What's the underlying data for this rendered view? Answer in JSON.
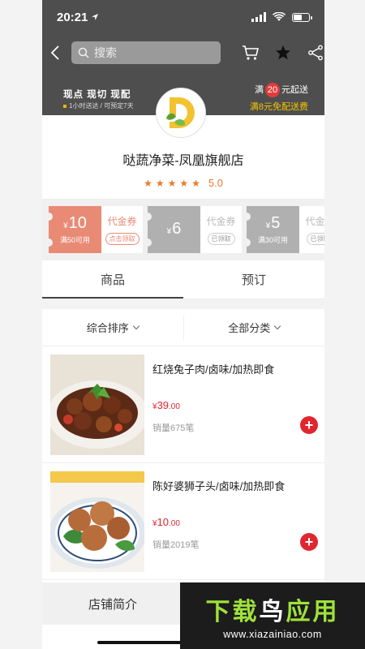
{
  "status": {
    "time": "20:21"
  },
  "search": {
    "placeholder": "搜索"
  },
  "banner": {
    "tags": "现点 现切 现配",
    "sub": "1小时送达 / 可预定7天",
    "min_prefix": "满",
    "min_amount": "20",
    "min_suffix": "元起送",
    "free_shipping": "满8元免配送费"
  },
  "shop": {
    "name": "哒蔬净菜-凤凰旗舰店",
    "stars": "★★★★★",
    "rating": "5.0"
  },
  "coupons": [
    {
      "amount": "10",
      "currency": "¥",
      "condition": "满50可用",
      "type": "代金券",
      "action": "点击领取",
      "state": "active"
    },
    {
      "amount": "6",
      "currency": "¥",
      "condition": "",
      "type": "代金券",
      "action": "已领取",
      "state": "used"
    },
    {
      "amount": "5",
      "currency": "¥",
      "condition": "满30可用",
      "type": "代金券",
      "action": "已领取",
      "state": "used"
    }
  ],
  "tabs": [
    {
      "label": "商品"
    },
    {
      "label": "预订"
    }
  ],
  "filters": [
    {
      "label": "综合排序"
    },
    {
      "label": "全部分类"
    }
  ],
  "products": [
    {
      "name": "红烧兔子肉/卤味/加热即食",
      "currency": "¥",
      "price_int": "39",
      "price_dec": ".00",
      "sales": "销量675笔"
    },
    {
      "name": "陈好婆狮子头/卤味/加热即食",
      "currency": "¥",
      "price_int": "10",
      "price_dec": ".00",
      "sales": "销量2019笔"
    }
  ],
  "bottom": {
    "intro": "店铺简介"
  },
  "watermark": {
    "brand_a": "下载",
    "brand_b": "鸟",
    "brand_c": "应用",
    "url": "www.xiazainiao.com"
  },
  "colors": {
    "header": "#4e4e4e",
    "accent": "#e0262f",
    "coupon_active": "#e98a74",
    "star": "#e87b2e"
  }
}
